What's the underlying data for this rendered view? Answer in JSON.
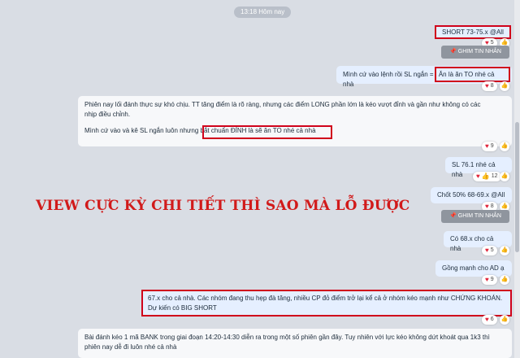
{
  "chat": {
    "time_divider": "13:18 Hôm nay",
    "msg_short": "SHORT 73-75.x @All",
    "msg_short_react": "5",
    "pin_label_1": "GHIM TIN NHẮN",
    "msg_enter_prefix": "Mình cứ vào lệnh rồi SL ngắn  =",
    "msg_enter_highlight": "Ăn là ăn TO nhé cả nhà",
    "msg_enter_react": "8",
    "msg_long_line1": "Phiên nay lối đánh thực sự khó chịu. TT tăng điểm là rõ ràng, nhưng các điểm LONG phần lớn là kéo vượt đỉnh và gần như không có các",
    "msg_long_line2": "nhịp điều chỉnh.",
    "msg_long_line3_prefix": "Mình cứ vào và kê SL ngắn luôn nhưng",
    "msg_long_line3_highlight": "bắt chuẩn ĐỈNH là sẽ ăn TO nhé cả nhà",
    "msg_long_react": "9",
    "msg_sl": "SL 76.1 nhé cả nhà",
    "msg_sl_react": "12",
    "msg_chot": "Chốt 50% 68-69.x @All",
    "msg_chot_react": "8",
    "pin_label_2": "GHIM TIN NHẮN",
    "msg_co68": "Có 68.x cho cả nhà",
    "msg_co68_react": "5",
    "msg_gong": "Gồng mạnh cho AD ạ",
    "msg_gong_react": "9",
    "msg_67_line1": "67.x cho cả nhà. Các nhóm đang thu hẹp đà tăng, nhiều CP đỏ điểm trở lại kể cả ở nhóm kéo mạnh như CHỨNG KHOÁN.",
    "msg_67_line2": "Dự kiến có BIG SHORT",
    "msg_67_react": "6",
    "msg_bank_line1": "Bài đánh kéo 1 mã BANK trong giai đoạn 14:20-14:30 diễn ra trong một số phiên gần đây. Tuy nhiên với lực kéo không dứt khoát qua 1k3 thì",
    "msg_bank_line2": "phiên nay dễ đi luôn nhé cả nhà"
  },
  "overlay_text": "VIEW CỰC KỲ CHI TIẾT THÌ SAO MÀ LỖ ĐƯỢC",
  "colors": {
    "highlight": "#d0021b",
    "my_bubble": "#e5efff",
    "other_bubble": "#f7f8fa",
    "overlay": "#d11a1a"
  }
}
